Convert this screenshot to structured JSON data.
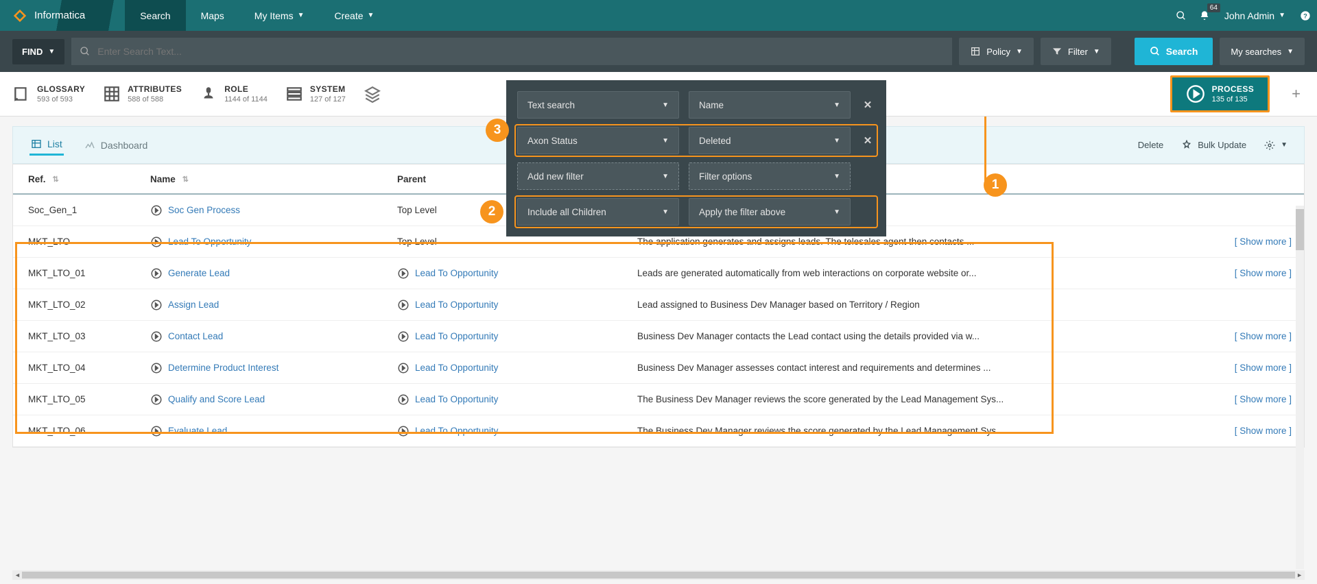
{
  "brand": "Informatica",
  "nav": {
    "search": "Search",
    "maps": "Maps",
    "myitems": "My Items",
    "create": "Create"
  },
  "notif_count": "64",
  "user": "John Admin",
  "find": "FIND",
  "search_placeholder": "Enter Search Text...",
  "policy_btn": "Policy",
  "filter_btn": "Filter",
  "search_btn": "Search",
  "mysearches": "My searches",
  "facets": {
    "glossary": {
      "title": "GLOSSARY",
      "count": "593 of 593"
    },
    "attributes": {
      "title": "ATTRIBUTES",
      "count": "588 of 588"
    },
    "role": {
      "title": "ROLE",
      "count": "1144 of 1144"
    },
    "system": {
      "title": "SYSTEM",
      "count": "127 of 127"
    },
    "process": {
      "title": "PROCESS",
      "count": "135 of 135"
    }
  },
  "tabs": {
    "list": "List",
    "dashboard": "Dashboard"
  },
  "actions": {
    "delete": "Delete",
    "bulk": "Bulk Update"
  },
  "cols": {
    "ref": "Ref.",
    "name": "Name",
    "parent": "Parent"
  },
  "filters": {
    "r1a": "Text search",
    "r1b": "Name",
    "r2a": "Axon Status",
    "r2b": "Deleted",
    "r3a": "Add new filter",
    "r3b": "Filter options",
    "r4a": "Include all Children",
    "r4b": "Apply the filter above"
  },
  "showmore": "[ Show more ]",
  "rows": [
    {
      "ref": "Soc_Gen_1",
      "name": "Soc Gen Process",
      "parent": "Top Level",
      "parent_link": false,
      "desc": "",
      "more": false
    },
    {
      "ref": "MKT_LTO",
      "name": "Lead To Opportunity",
      "parent": "Top Level",
      "parent_link": false,
      "desc": "The application generates and assigns leads. The telesales agent then contacts ...",
      "more": true
    },
    {
      "ref": "MKT_LTO_01",
      "name": "Generate Lead",
      "parent": "Lead To Opportunity",
      "parent_link": true,
      "desc": "Leads are generated automatically from web interactions on corporate website or...",
      "more": true
    },
    {
      "ref": "MKT_LTO_02",
      "name": "Assign Lead",
      "parent": "Lead To Opportunity",
      "parent_link": true,
      "desc": "Lead assigned to Business Dev Manager based on Territory / Region",
      "more": false
    },
    {
      "ref": "MKT_LTO_03",
      "name": "Contact Lead",
      "parent": "Lead To Opportunity",
      "parent_link": true,
      "desc": "Business Dev Manager contacts the Lead contact using the details provided via w...",
      "more": true
    },
    {
      "ref": "MKT_LTO_04",
      "name": "Determine Product Interest",
      "parent": "Lead To Opportunity",
      "parent_link": true,
      "desc": "Business Dev Manager assesses contact interest and requirements and determines ...",
      "more": true
    },
    {
      "ref": "MKT_LTO_05",
      "name": "Qualify and Score Lead",
      "parent": "Lead To Opportunity",
      "parent_link": true,
      "desc": "The Business Dev Manager reviews the score generated by the Lead Management Sys...",
      "more": true
    },
    {
      "ref": "MKT_LTO_06",
      "name": "Evaluate Lead",
      "parent": "Lead To Opportunity",
      "parent_link": true,
      "desc": "The Business Dev Manager reviews the score generated by the Lead Management Sys...",
      "more": true
    }
  ]
}
